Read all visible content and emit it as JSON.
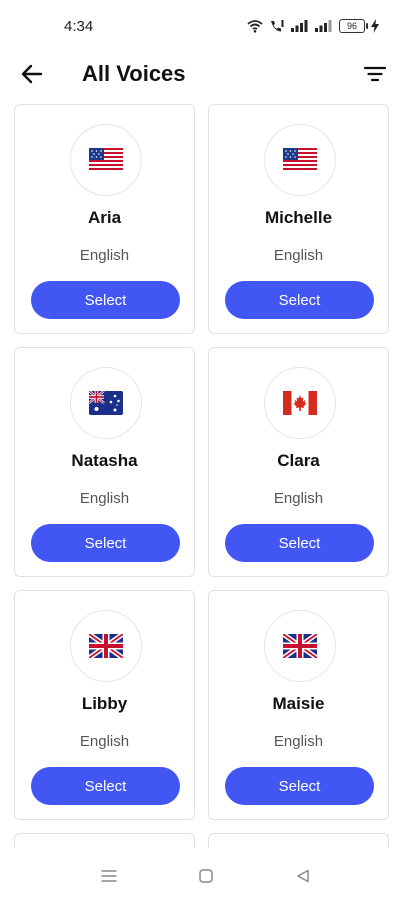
{
  "status": {
    "time": "4:34",
    "battery": "96"
  },
  "header": {
    "title": "All Voices",
    "back_icon": "arrow-left-icon",
    "filter_icon": "filter-icon"
  },
  "voices": [
    {
      "name": "Aria",
      "language": "English",
      "flag": "us-flag-icon",
      "button": "Select"
    },
    {
      "name": "Michelle",
      "language": "English",
      "flag": "us-flag-icon",
      "button": "Select"
    },
    {
      "name": "Natasha",
      "language": "English",
      "flag": "au-flag-icon",
      "button": "Select"
    },
    {
      "name": "Clara",
      "language": "English",
      "flag": "ca-flag-icon",
      "button": "Select"
    },
    {
      "name": "Libby",
      "language": "English",
      "flag": "uk-flag-icon",
      "button": "Select"
    },
    {
      "name": "Maisie",
      "language": "English",
      "flag": "uk-flag-icon",
      "button": "Select"
    }
  ],
  "colors": {
    "accent": "#4256f4",
    "card_border": "#e1e1e1"
  }
}
